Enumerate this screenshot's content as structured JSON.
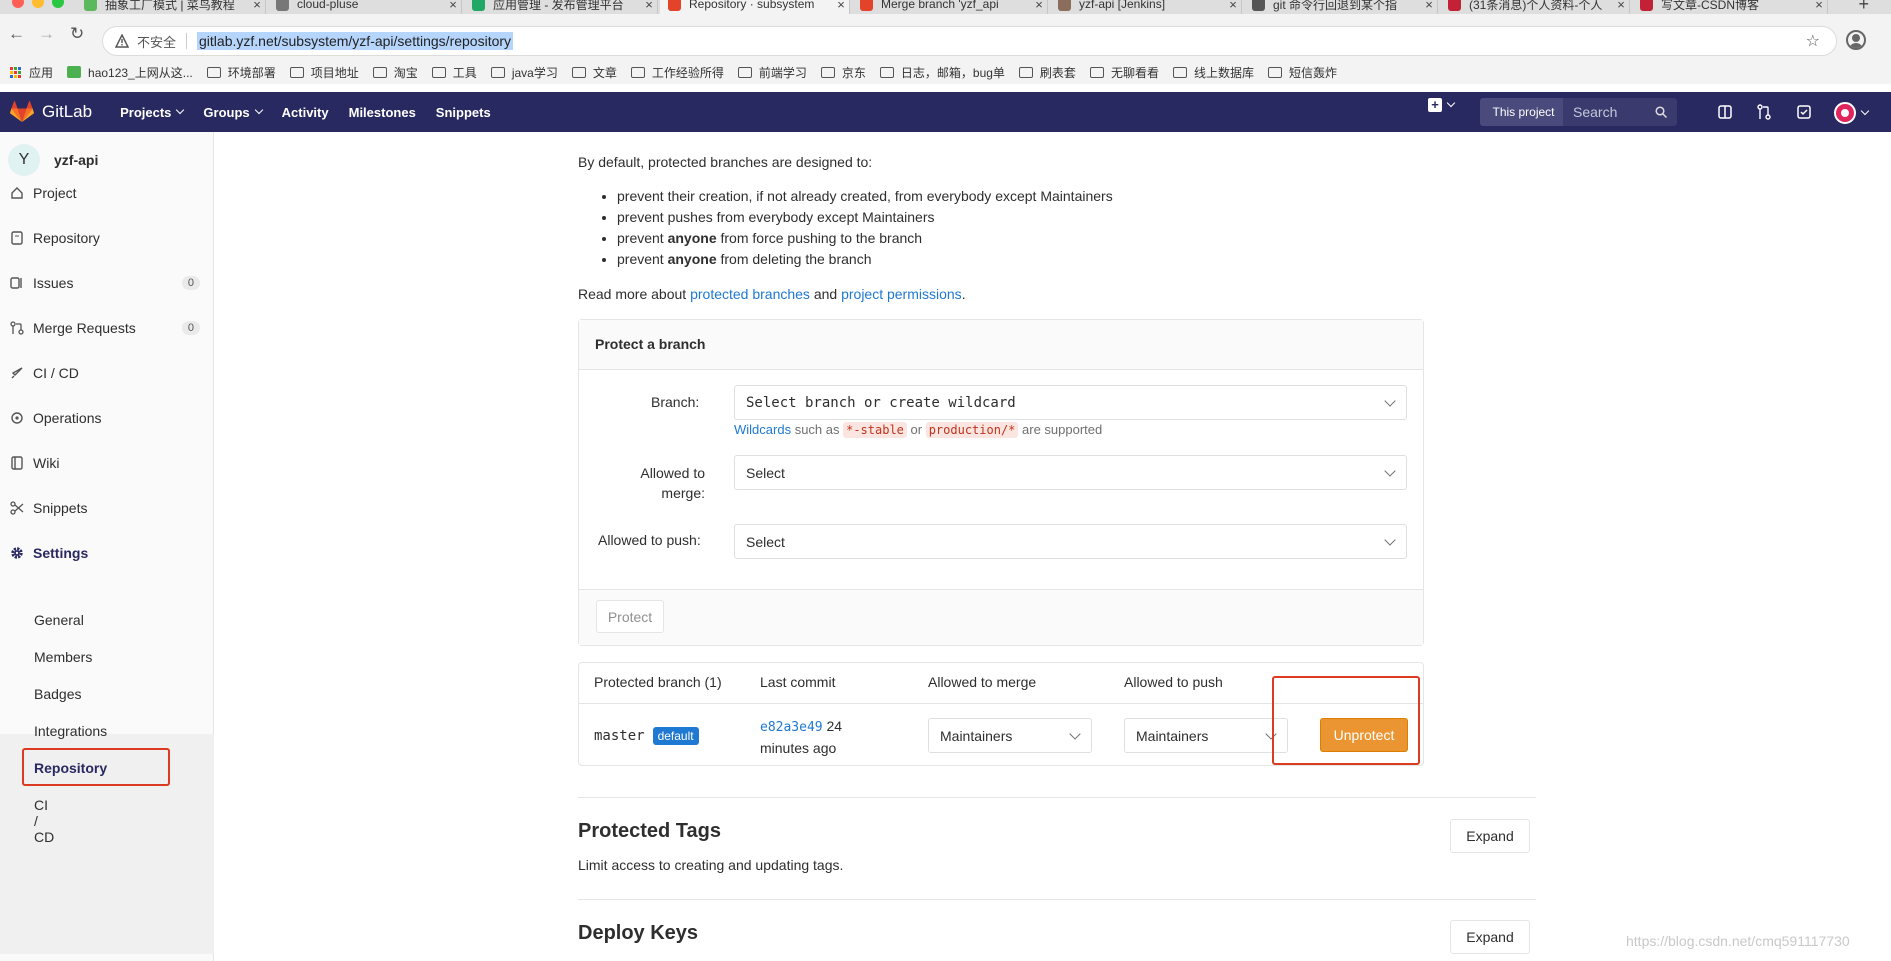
{
  "browser": {
    "tabs": [
      {
        "title": "抽象工厂模式 | 菜鸟教程",
        "color": "#5cb85c"
      },
      {
        "title": "cloud-pluse",
        "color": "#777777"
      },
      {
        "title": "应用管理 - 发布管理平台",
        "color": "#22a866"
      },
      {
        "title": "Repository · subsystem",
        "color": "#e24329",
        "active": true
      },
      {
        "title": "Merge branch 'yzf_api",
        "color": "#e24329"
      },
      {
        "title": "yzf-api [Jenkins]",
        "color": "#8b6d5c"
      },
      {
        "title": "git 命令行回退到某个指",
        "color": "#555555"
      },
      {
        "title": "(31条消息)个人资料-个人",
        "color": "#c32136"
      },
      {
        "title": "写文章-CSDN博客",
        "color": "#c32136"
      }
    ],
    "insecure_label": "不安全",
    "url": "gitlab.yzf.net/subsystem/yzf-api/settings/repository",
    "bookmarks": [
      "应用",
      "hao123_上网从这...",
      "环境部署",
      "项目地址",
      "淘宝",
      "工具",
      "java学习",
      "文章",
      "工作经验所得",
      "前端学习",
      "京东",
      "日志，邮箱，bug单",
      "刷表套",
      "无聊看看",
      "线上数据库",
      "短信轰炸"
    ]
  },
  "header": {
    "brand": "GitLab",
    "nav": [
      "Projects",
      "Groups",
      "Activity",
      "Milestones",
      "Snippets"
    ],
    "scope_label": "This project",
    "search_placeholder": "Search"
  },
  "sidebar": {
    "project_initial": "Y",
    "project_name": "yzf-api",
    "items": [
      {
        "label": "Project",
        "icon": "home-icon"
      },
      {
        "label": "Repository",
        "icon": "doc-icon"
      },
      {
        "label": "Issues",
        "icon": "issues-icon",
        "count": "0"
      },
      {
        "label": "Merge Requests",
        "icon": "merge-request-icon",
        "count": "0"
      },
      {
        "label": "CI / CD",
        "icon": "rocket-icon"
      },
      {
        "label": "Operations",
        "icon": "cloud-gear-icon"
      },
      {
        "label": "Wiki",
        "icon": "book-icon"
      },
      {
        "label": "Snippets",
        "icon": "scissors-icon"
      },
      {
        "label": "Settings",
        "icon": "gear-icon"
      }
    ],
    "settings_sub": [
      "General",
      "Members",
      "Badges",
      "Integrations",
      "Repository",
      "CI / CD"
    ]
  },
  "content": {
    "intro": "By default, protected branches are designed to:",
    "bullets": [
      {
        "pre": "prevent their creation, if not already created, from everybody except Maintainers",
        "bold": "",
        "post": ""
      },
      {
        "pre": "prevent pushes from everybody except Maintainers",
        "bold": "",
        "post": ""
      },
      {
        "pre": "prevent ",
        "bold": "anyone",
        "post": " from force pushing to the branch"
      },
      {
        "pre": "prevent ",
        "bold": "anyone",
        "post": " from deleting the branch"
      }
    ],
    "read_more": "Read more about ",
    "link1": "protected branches",
    "and": " and ",
    "link2": "project permissions",
    "period": ".",
    "protect_panel": {
      "title": "Protect a branch",
      "branch_label": "Branch:",
      "branch_placeholder": "Select branch or create wildcard",
      "wildcards_link": "Wildcards",
      "such_as": " such as ",
      "code1": "*-stable",
      "or": " or ",
      "code2": "production/*",
      "supported": " are supported",
      "merge_label_1": "Allowed to",
      "merge_label_2": "merge:",
      "merge_value": "Select",
      "push_label": "Allowed to push:",
      "push_value": "Select",
      "protect_button": "Protect"
    },
    "table": {
      "headers": [
        "Protected branch (1)",
        "Last commit",
        "Allowed to merge",
        "Allowed to push"
      ],
      "row": {
        "branch": "master",
        "badge": "default",
        "commit": "e82a3e49",
        "commit_time_1": " 24",
        "commit_time_2": "minutes ago",
        "merge": "Maintainers",
        "push": "Maintainers",
        "unprotect": "Unprotect"
      }
    },
    "tags": {
      "title": "Protected Tags",
      "desc": "Limit access to creating and updating tags.",
      "expand": "Expand"
    },
    "deploy": {
      "title": "Deploy Keys",
      "expand": "Expand"
    },
    "watermark": "https://blog.csdn.net/cmq591117730"
  },
  "colors": {
    "header_bg": "#292961",
    "accent": "#1f78d1",
    "unprotect": "#eb9532",
    "highlight": "#db3b21"
  }
}
